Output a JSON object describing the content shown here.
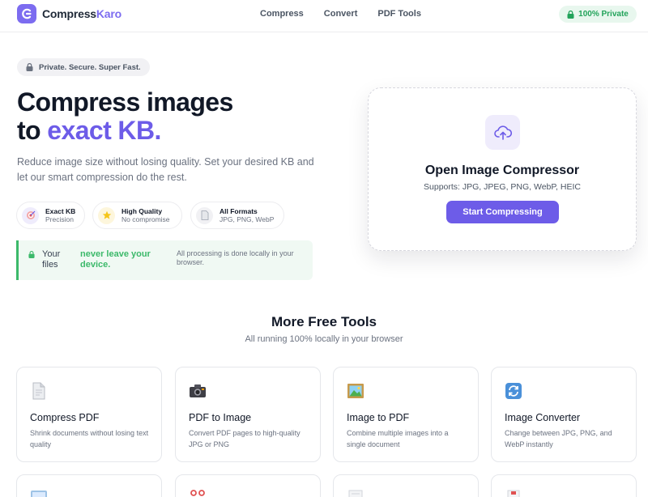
{
  "header": {
    "brand_part1": "Compress",
    "brand_part2": "Karo",
    "nav": [
      "Compress",
      "Convert",
      "PDF Tools"
    ],
    "private_badge": "100% Private"
  },
  "hero": {
    "pill": "Private. Secure. Super Fast.",
    "title_line1": "Compress images",
    "title_line2_prefix": "to ",
    "title_line2_accent": "exact KB.",
    "description": "Reduce image size without losing quality. Set your desired KB and let our smart compression do the rest.",
    "features": [
      {
        "title": "Exact KB",
        "subtitle": "Precision",
        "icon": "target-icon"
      },
      {
        "title": "High Quality",
        "subtitle": "No compromise",
        "icon": "star-icon"
      },
      {
        "title": "All Formats",
        "subtitle": "JPG, PNG, WebP",
        "icon": "file-icon"
      }
    ],
    "notice": {
      "part1": "Your files",
      "part2": "never leave your device.",
      "part3": "All processing is done locally in your browser."
    }
  },
  "upload": {
    "title": "Open Image Compressor",
    "supports": "Supports: JPG, JPEG, PNG, WebP, HEIC",
    "button": "Start Compressing"
  },
  "more_tools": {
    "title": "More Free Tools",
    "subtitle": "All running 100% locally in your browser",
    "tools": [
      {
        "name": "Compress PDF",
        "description": "Shrink documents without losing text quality",
        "icon": "document-icon"
      },
      {
        "name": "PDF to Image",
        "description": "Convert PDF pages to high-quality JPG or PNG",
        "icon": "camera-icon"
      },
      {
        "name": "Image to PDF",
        "description": "Combine multiple images into a single document",
        "icon": "picture-icon"
      },
      {
        "name": "Image Converter",
        "description": "Change between JPG, PNG, and WebP instantly",
        "icon": "refresh-icon"
      }
    ]
  },
  "colors": {
    "accent": "#6d5ce8",
    "green": "#3cb96a"
  }
}
